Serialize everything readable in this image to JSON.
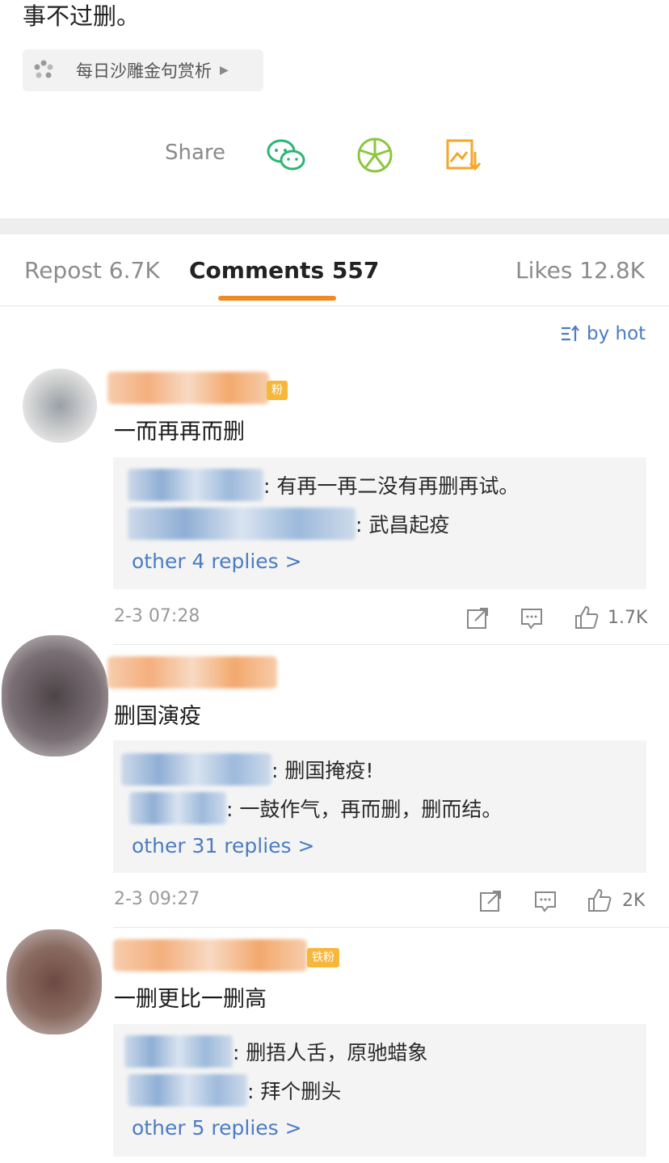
{
  "post": {
    "text_tail": "事不过删。",
    "topic": "每日沙雕金句赏析"
  },
  "share": {
    "label": "Share",
    "icons": [
      "wechat-icon",
      "moments-icon",
      "save-image-icon"
    ]
  },
  "tabs": [
    {
      "label": "Repost 6.7K",
      "active": false
    },
    {
      "label": "Comments 557",
      "active": true
    },
    {
      "label": "Likes 12.8K",
      "active": false
    }
  ],
  "sort": {
    "label": "by hot"
  },
  "colors": {
    "accent": "#f08a24",
    "link": "#4b7cc2",
    "fan_badge": "#f6b73b"
  },
  "comments": [
    {
      "badge": "粉",
      "text": "一而再再而删",
      "replies": [
        ": 有再一再二没有再删再试。",
        ": 武昌起疫"
      ],
      "more": "other 4 replies >",
      "time": "2-3 07:28",
      "likes": "1.7K"
    },
    {
      "badge": "",
      "text": "删国演疫",
      "replies": [
        ": 删国掩疫!",
        ": 一鼓作气，再而删，删而结。"
      ],
      "more": "other 31 replies >",
      "time": "2-3 09:27",
      "likes": "2K"
    },
    {
      "badge": "铁粉",
      "text": "一删更比一删高",
      "replies": [
        ": 删捂人舌，原驰蜡象",
        ": 拜个删头"
      ],
      "more": "other 5 replies >",
      "time": "",
      "likes": ""
    }
  ]
}
